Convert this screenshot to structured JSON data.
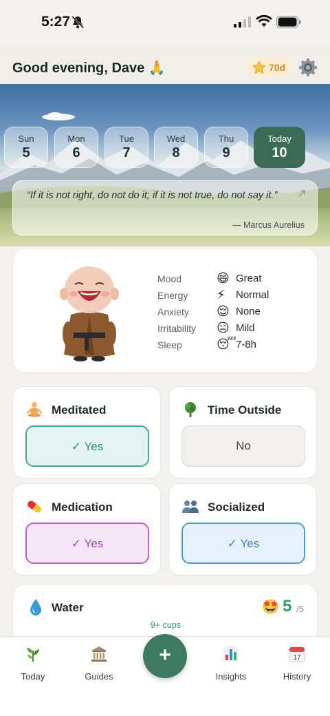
{
  "status_bar": {
    "time": "5:27"
  },
  "header": {
    "greeting": "Good evening, Dave 🙏",
    "streak": "70d"
  },
  "week": [
    {
      "day": "Sun",
      "date": "5"
    },
    {
      "day": "Mon",
      "date": "6"
    },
    {
      "day": "Tue",
      "date": "7"
    },
    {
      "day": "Wed",
      "date": "8"
    },
    {
      "day": "Thu",
      "date": "9"
    },
    {
      "day": "Today",
      "date": "10"
    }
  ],
  "quote": {
    "text": "“If it is not right, do not do it; if it is not true, do not say it.”",
    "author": "— Marcus Aurelius"
  },
  "mood": {
    "metrics": [
      {
        "label": "Mood",
        "emoji": "😄",
        "value": "Great"
      },
      {
        "label": "Energy",
        "emoji": "⚡",
        "value": "Normal"
      },
      {
        "label": "Anxiety",
        "emoji": "😌",
        "value": "None"
      },
      {
        "label": "Irritability",
        "emoji": "😑",
        "value": "Mild"
      },
      {
        "label": "Sleep",
        "emoji": "😴",
        "value": "7-8h"
      }
    ]
  },
  "habits": {
    "meditated": {
      "title": "Meditated",
      "value": "✓ Yes"
    },
    "time_outside": {
      "title": "Time Outside",
      "value": "No"
    },
    "medication": {
      "title": "Medication",
      "value": "✓ Yes"
    },
    "socialized": {
      "title": "Socialized",
      "value": "✓ Yes"
    }
  },
  "water": {
    "title": "Water",
    "emoji": "🤩",
    "count": "5",
    "total": "/5",
    "cups": "9+ cups"
  },
  "tabs": {
    "today": "Today",
    "guides": "Guides",
    "add": "+",
    "insights": "Insights",
    "history": "History"
  },
  "colors": {
    "accent_green": "#3e7a62",
    "teal": "#3fa696",
    "purple": "#b95fc8",
    "blue": "#4f9ad8",
    "streak_orange": "#d9892a"
  }
}
